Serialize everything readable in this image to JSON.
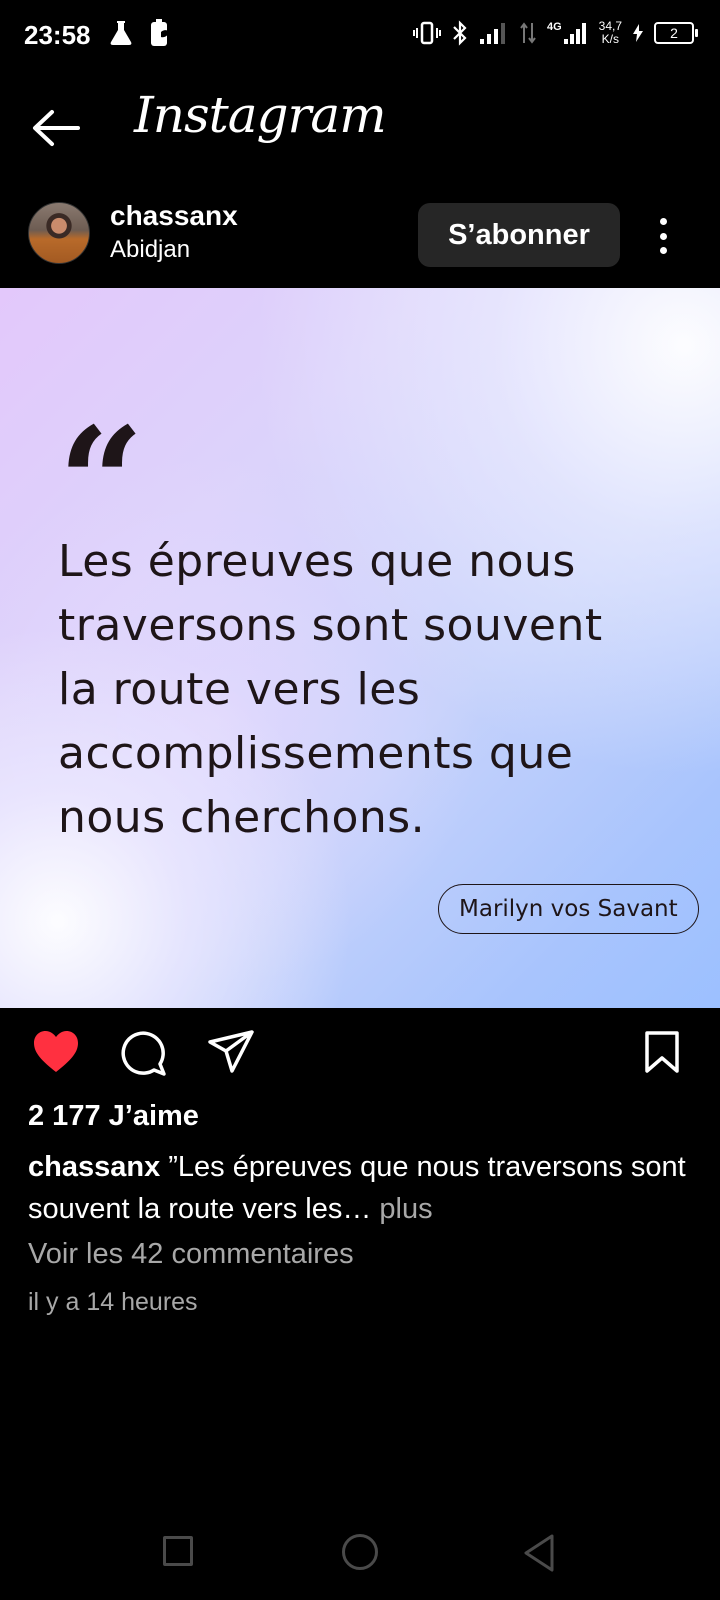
{
  "status_bar": {
    "time": "23:58",
    "network_type": "4G",
    "speed_value": "34,7",
    "speed_unit": "K/s",
    "battery_level": "2"
  },
  "header": {
    "title": "Instagram",
    "back_icon": "arrow-left-icon"
  },
  "post": {
    "username": "chassanx",
    "location": "Abidjan",
    "follow_label": "S’abonner",
    "image": {
      "quote_glyph": "“",
      "quote_text": "Les épreuves que nous traversons sont souvent la route vers les accomplissements que nous cherchons.",
      "author": "Marilyn vos Savant",
      "colors": {
        "text": "#1e1518",
        "gradient_start": "#e3c8fb",
        "gradient_end": "#9cc0ff"
      }
    },
    "likes": "2 177 J’aime",
    "caption_user": "chassanx",
    "caption_text": " ”Les épreuves que nous traversons sont souvent la route vers les…",
    "caption_more": " plus",
    "view_comments": "Voir les 42 commentaires",
    "timestamp": "il y a 14 heures",
    "liked": true,
    "like_color": "#ff3040"
  }
}
